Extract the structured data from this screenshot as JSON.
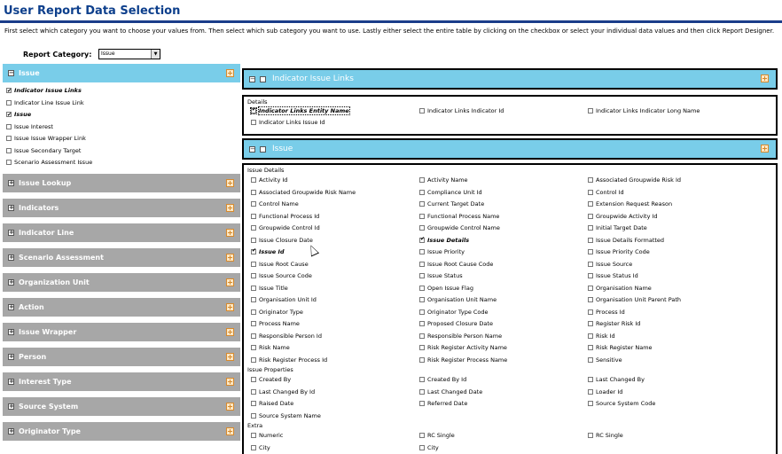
{
  "page": {
    "title": "User Report Data Selection",
    "intro": "First select which category you want to choose your values from. Then select which sub category you want to use. Lastly either select the entire table by clicking on the checkbox or select your individual data values and then click Report Designer.",
    "report_category_label": "Report Category:",
    "report_category_value": "Issue"
  },
  "left": {
    "expanded": {
      "title": "Issue",
      "items": [
        {
          "label": "Indicator Issue Links",
          "checked": true
        },
        {
          "label": "Indicator Line Issue Link",
          "checked": false
        },
        {
          "label": "Issue",
          "checked": true
        },
        {
          "label": "Issue Interest",
          "checked": false
        },
        {
          "label": "Issue Issue Wrapper Link",
          "checked": false
        },
        {
          "label": "Issue Secondary Target",
          "checked": false
        },
        {
          "label": "Scenario Assessment Issue",
          "checked": false
        }
      ]
    },
    "categories": [
      "Issue Lookup",
      "Indicators",
      "Indicator Line",
      "Scenario Assessment",
      "Organization Unit",
      "Action",
      "Issue Wrapper",
      "Person",
      "Interest Type",
      "Source System",
      "Originator Type"
    ]
  },
  "panel1": {
    "title": "Indicator Issue Links",
    "section": "Details",
    "fields": [
      {
        "label": "Indicator Links Entity Name",
        "checked": true
      },
      {
        "label": "Indicator Links Indicator Id",
        "checked": false
      },
      {
        "label": "Indicator Links Indicator Long Name",
        "checked": false
      },
      {
        "label": "Indicator Links Issue Id",
        "checked": false
      }
    ]
  },
  "panel2": {
    "title": "Issue",
    "sections": [
      {
        "name": "Issue Details",
        "fields": [
          {
            "label": "Activity Id",
            "checked": false
          },
          {
            "label": "Activity Name",
            "checked": false
          },
          {
            "label": "Associated Groupwide Risk Id",
            "checked": false
          },
          {
            "label": "Associated Groupwide Risk Name",
            "checked": false
          },
          {
            "label": "Compliance Unit Id",
            "checked": false
          },
          {
            "label": "Control Id",
            "checked": false
          },
          {
            "label": "Control Name",
            "checked": false
          },
          {
            "label": "Current Target Date",
            "checked": false
          },
          {
            "label": "Extension Request Reason",
            "checked": false
          },
          {
            "label": "Functional Process Id",
            "checked": false
          },
          {
            "label": "Functional Process Name",
            "checked": false
          },
          {
            "label": "Groupwide Activity Id",
            "checked": false
          },
          {
            "label": "Groupwide Control Id",
            "checked": false
          },
          {
            "label": "Groupwide Control Name",
            "checked": false
          },
          {
            "label": "Initial Target Date",
            "checked": false
          },
          {
            "label": "Issue Closure Date",
            "checked": false
          },
          {
            "label": "Issue Details",
            "checked": true
          },
          {
            "label": "Issue Details Formatted",
            "checked": false
          },
          {
            "label": "Issue Id",
            "checked": true
          },
          {
            "label": "Issue Priority",
            "checked": false
          },
          {
            "label": "Issue Priority Code",
            "checked": false
          },
          {
            "label": "Issue Root Cause",
            "checked": false
          },
          {
            "label": "Issue Root Cause Code",
            "checked": false
          },
          {
            "label": "Issue Source",
            "checked": false
          },
          {
            "label": "Issue Source Code",
            "checked": false
          },
          {
            "label": "Issue Status",
            "checked": false
          },
          {
            "label": "Issue Status Id",
            "checked": false
          },
          {
            "label": "Issue Title",
            "checked": false
          },
          {
            "label": "Open Issue Flag",
            "checked": false
          },
          {
            "label": "Organisation Name",
            "checked": false
          },
          {
            "label": "Organisation Unit Id",
            "checked": false
          },
          {
            "label": "Organisation Unit Name",
            "checked": false
          },
          {
            "label": "Organisation Unit Parent Path",
            "checked": false
          },
          {
            "label": "Originator Type",
            "checked": false
          },
          {
            "label": "Originator Type Code",
            "checked": false
          },
          {
            "label": "Process Id",
            "checked": false
          },
          {
            "label": "Process Name",
            "checked": false
          },
          {
            "label": "Proposed Closure Date",
            "checked": false
          },
          {
            "label": "Register Risk Id",
            "checked": false
          },
          {
            "label": "Responsible Person Id",
            "checked": false
          },
          {
            "label": "Responsible Person Name",
            "checked": false
          },
          {
            "label": "Risk Id",
            "checked": false
          },
          {
            "label": "Risk Name",
            "checked": false
          },
          {
            "label": "Risk Register Activity Name",
            "checked": false
          },
          {
            "label": "Risk Register Name",
            "checked": false
          },
          {
            "label": "Risk Register Process Id",
            "checked": false
          },
          {
            "label": "Risk Register Process Name",
            "checked": false
          },
          {
            "label": "Sensitive",
            "checked": false
          }
        ]
      },
      {
        "name": "Issue Properties",
        "fields": [
          {
            "label": "Created By",
            "checked": false
          },
          {
            "label": "Created By Id",
            "checked": false
          },
          {
            "label": "Last Changed By",
            "checked": false
          },
          {
            "label": "Last Changed By Id",
            "checked": false
          },
          {
            "label": "Last Changed Date",
            "checked": false
          },
          {
            "label": "Loader Id",
            "checked": false
          },
          {
            "label": "Raised Date",
            "checked": false
          },
          {
            "label": "Referred Date",
            "checked": false
          },
          {
            "label": "Source System Code",
            "checked": false
          },
          {
            "label": "Source System Name",
            "checked": false
          }
        ]
      },
      {
        "name": "Extra",
        "fields": [
          {
            "label": "Numeric",
            "checked": false
          },
          {
            "label": "RC Single",
            "checked": false
          },
          {
            "label": "RC Single",
            "checked": false
          },
          {
            "label": "City",
            "checked": false
          },
          {
            "label": "City",
            "checked": false
          }
        ]
      }
    ]
  },
  "colors": {
    "title": "#0d3f8c",
    "header_blue": "#79cde9",
    "header_gray": "#a7a7a7"
  }
}
